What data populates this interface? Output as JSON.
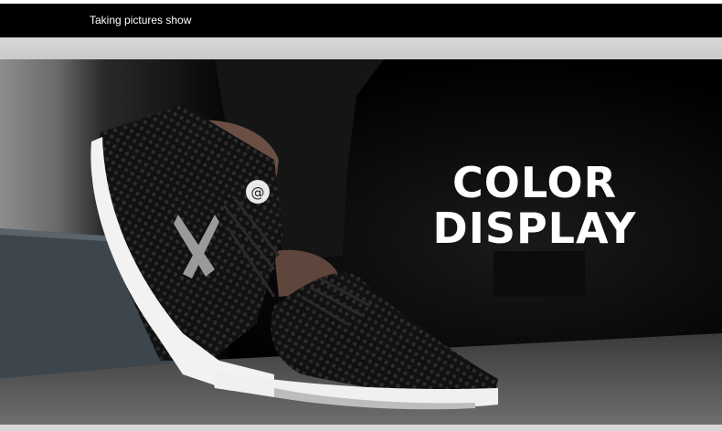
{
  "header": {
    "title": "Taking pictures show"
  },
  "hero": {
    "image": "sneaker-photo",
    "headline_line1": "COLOR",
    "headline_line2": "DISPLAY",
    "logo_mark": "@"
  },
  "colors": {
    "header_bg": "#000000",
    "band_bg": "#d0d0d0",
    "headline": "#ffffff"
  }
}
